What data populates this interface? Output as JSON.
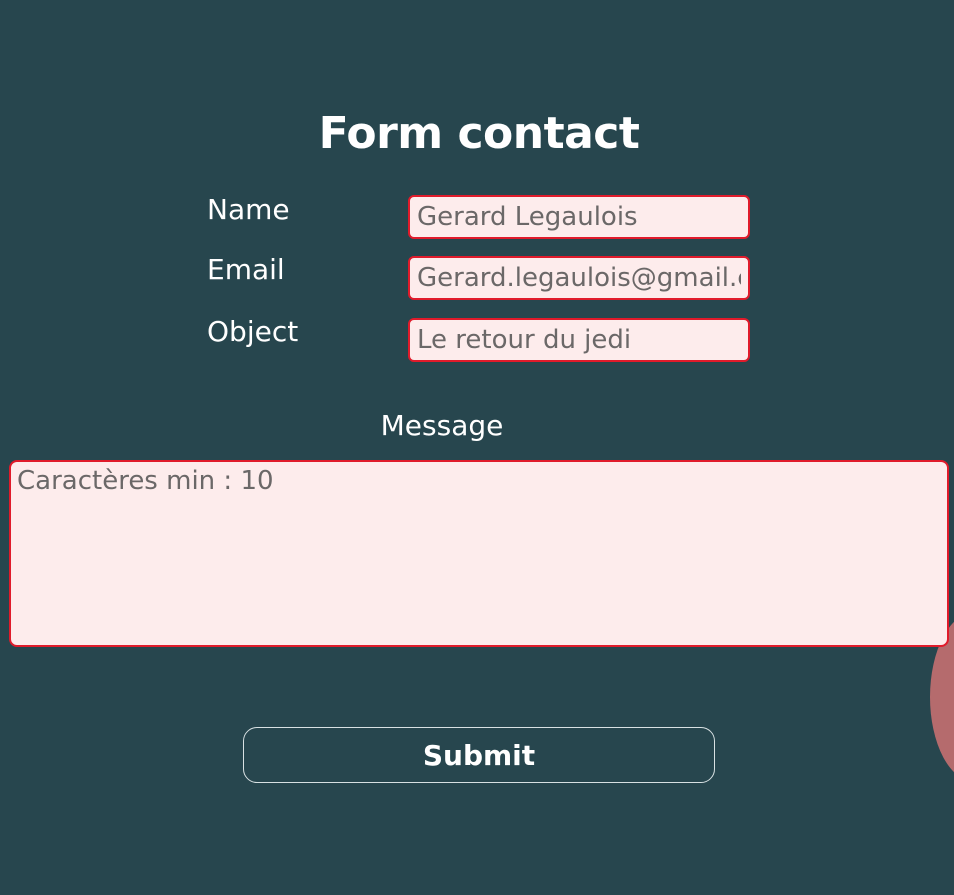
{
  "form": {
    "title": "Form contact",
    "fields": [
      {
        "label": "Name",
        "value": "Gerard Legaulois"
      },
      {
        "label": "Email",
        "value": "Gerard.legaulois@gmail.com"
      },
      {
        "label": "Object",
        "value": "Le retour du jedi"
      }
    ],
    "message": {
      "label": "Message",
      "placeholder": "Caractères min : 10"
    },
    "submit_label": "Submit"
  },
  "colors": {
    "background": "#27464e",
    "input_background": "#fdecec",
    "input_border": "#e01b2b",
    "text": "#ffffff",
    "input_text": "#6b6868"
  }
}
